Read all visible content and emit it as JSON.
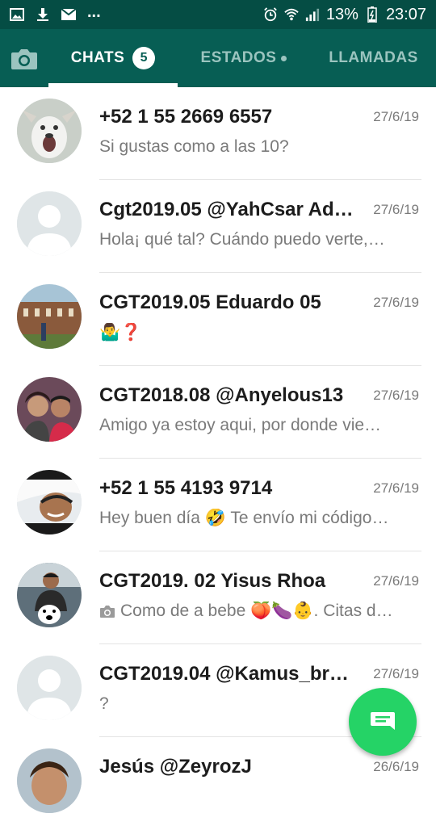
{
  "status_bar": {
    "icons": [
      "image-icon",
      "download-icon",
      "mail-icon"
    ],
    "overflow": "...",
    "right_icons": [
      "alarm-icon",
      "wifi-icon",
      "signal-icon"
    ],
    "battery": "13%",
    "time": "23:07"
  },
  "tabs": [
    {
      "label": "CHATS",
      "badge": "5",
      "active": true
    },
    {
      "label": "ESTADOS",
      "active": false
    },
    {
      "label": "LLAMADAS",
      "active": false
    }
  ],
  "chats": [
    {
      "name": "+52 1 55 2669 6557",
      "time": "27/6/19",
      "message": "Si gustas como a las 10?"
    },
    {
      "name": "Cgt2019.05 @YahCsar Ad…",
      "time": "27/6/19",
      "message": "Hola¡ qué tal? Cuándo puedo verte,…"
    },
    {
      "name": "CGT2019.05 Eduardo 05",
      "time": "27/6/19",
      "message": "🤷‍♂️❓"
    },
    {
      "name": "CGT2018.08 @Anyelous13",
      "time": "27/6/19",
      "message": "Amigo ya estoy aqui, por donde vie…"
    },
    {
      "name": "+52 1 55 4193 9714",
      "time": "27/6/19",
      "message": "Hey buen día 🤣 Te envío mi código…"
    },
    {
      "name": "CGT2019. 02 Yisus Rhoa",
      "time": "27/6/19",
      "message": "Como de a bebe 🍑🍆👶. Citas d…"
    },
    {
      "name": "CGT2019.04 @Kamus_br…",
      "time": "27/6/19",
      "message": "?"
    },
    {
      "name": "Jesús @ZeyrozJ",
      "time": "26/6/19",
      "message": ""
    }
  ],
  "fab": {
    "icon": "new-chat-icon"
  },
  "colors": {
    "header": "#075e54",
    "status_bar": "#054d44",
    "fab": "#25d366"
  }
}
